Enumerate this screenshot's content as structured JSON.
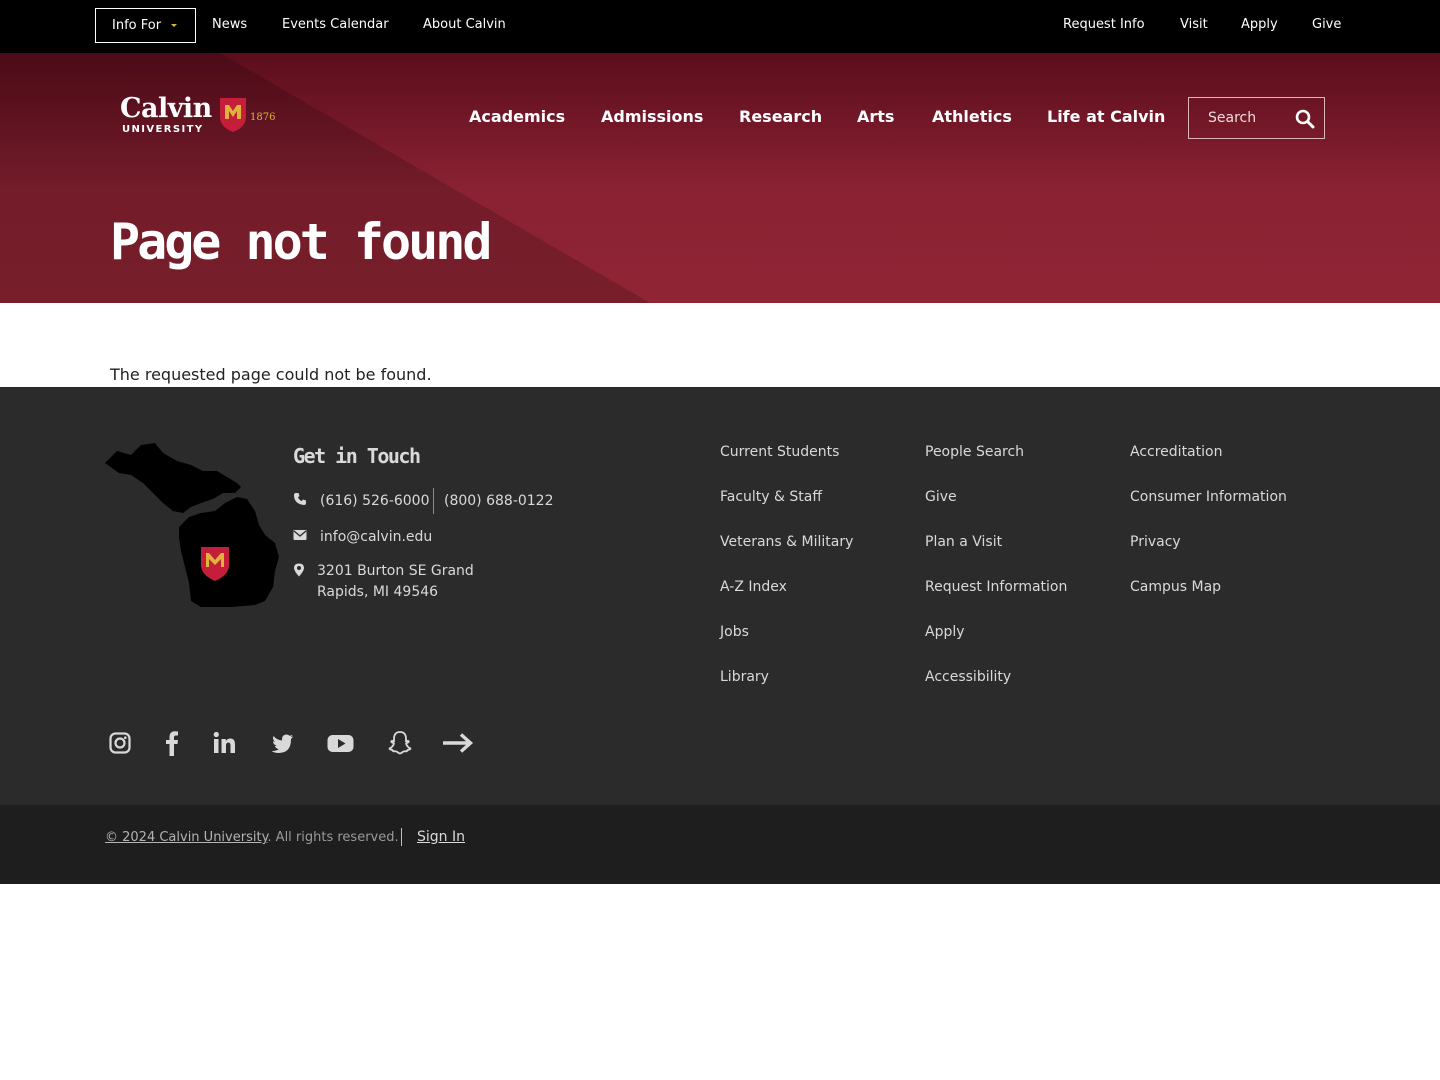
{
  "utility": {
    "info_for": "Info For",
    "left_links": [
      "News",
      "Events Calendar",
      "About Calvin"
    ],
    "right_links": [
      "Request Info",
      "Visit",
      "Apply",
      "Give"
    ]
  },
  "brand": {
    "wordmark": "Calvin",
    "subtitle": "UNIVERSITY",
    "year": "1876",
    "accent": "#e0b43a",
    "maroon": "#8f2434",
    "shield_red": "#c41e3a"
  },
  "nav": {
    "items": [
      "Academics",
      "Admissions",
      "Research",
      "Arts",
      "Athletics",
      "Life at Calvin"
    ]
  },
  "search": {
    "placeholder": "Search"
  },
  "page": {
    "title": "Page not found",
    "message": "The requested page could not be found."
  },
  "footer": {
    "get_in_touch": "Get in Touch",
    "phone_local": "(616) 526-6000",
    "phone_toll_free": "(800) 688-0122",
    "email": "info@calvin.edu",
    "address_line1": "3201 Burton SE Grand",
    "address_line2": "Rapids, MI 49546",
    "col1": [
      "Current Students",
      "Faculty & Staff",
      "Veterans & Military",
      "A-Z Index",
      "Jobs",
      "Library"
    ],
    "col2": [
      "People Search",
      "Give",
      "Plan a Visit",
      "Request Information",
      "Apply",
      "Accessibility"
    ],
    "col3": [
      "Accreditation",
      "Consumer Information",
      "Privacy",
      "Campus Map"
    ],
    "social": [
      "instagram-icon",
      "facebook-icon",
      "linkedin-icon",
      "twitter-icon",
      "youtube-icon",
      "snapchat-icon",
      "more-arrow-icon"
    ]
  },
  "bottom": {
    "copyright_link": "© 2024 Calvin University",
    "copyright_rest": ". All rights reserved.",
    "sign_in": "Sign In"
  }
}
